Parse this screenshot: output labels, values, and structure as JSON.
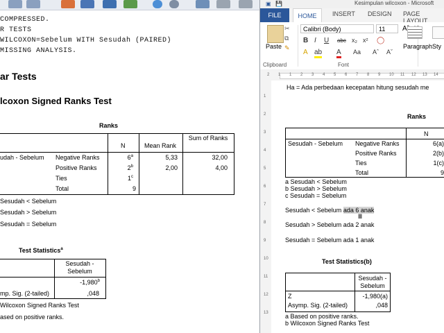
{
  "spss": {
    "syntax_lines": [
      "COMPRESSED.",
      "R TESTS",
      "WILCOXON=Sebelum WITH Sesudah (PAIRED)",
      "MISSING ANALYSIS."
    ],
    "section_title": "ar Tests",
    "subsection_title": "lcoxon Signed Ranks Test",
    "ranks": {
      "title": "Ranks",
      "headers": [
        "N",
        "Mean Rank",
        "Sum of Ranks"
      ],
      "pair_label": "udah - Sebelum",
      "rows": [
        {
          "label": "Negative Ranks",
          "n": "6",
          "sup": "a",
          "mean": "5,33",
          "sum": "32,00"
        },
        {
          "label": "Positive Ranks",
          "n": "2",
          "sup": "b",
          "mean": "2,00",
          "sum": "4,00"
        },
        {
          "label": "Ties",
          "n": "1",
          "sup": "c",
          "mean": "",
          "sum": ""
        },
        {
          "label": "Total",
          "n": "9",
          "sup": "",
          "mean": "",
          "sum": ""
        }
      ],
      "footnotes": [
        "Sesudah < Sebelum",
        "Sesudah > Sebelum",
        "Sesudah = Sebelum"
      ]
    },
    "test_stats": {
      "title": "Test Statistics",
      "title_sup": "a",
      "header": "Sesudah - Sebelum",
      "z_value": "-1,980",
      "z_sup": "b",
      "sig_label": "mp. Sig. (2-tailed)",
      "sig_value": ",048",
      "footnotes": [
        "Wilcoxon Signed Ranks Test",
        "ased on positive ranks."
      ]
    }
  },
  "word": {
    "window_title": "Kesimpulan wilcoxon - Microsoft",
    "tabs": [
      "FILE",
      "HOME",
      "INSERT",
      "DESIGN",
      "PAGE LAYOUT"
    ],
    "font_name": "Calibri (Body)",
    "font_size": "11",
    "group_labels": {
      "clipboard": "Clipboard",
      "font": "Font",
      "paragraph": "Paragraph",
      "styles": "Sty"
    },
    "paste_label": "Paste",
    "ruler_numbers": [
      "2",
      "1",
      "1",
      "2",
      "3",
      "4",
      "5",
      "6",
      "7",
      "8",
      "9",
      "10",
      "11",
      "12",
      "13",
      "14"
    ],
    "vruler_numbers": [
      "1",
      "2",
      "3",
      "4",
      "5",
      "6",
      "7",
      "8",
      "9",
      "10",
      "11",
      "12",
      "13"
    ],
    "doc": {
      "intro": "Ha = Ada perbedaan kecepatan hitung sesudah me",
      "ranks_title": "Ranks",
      "ranks_header_n": "N",
      "pair_label": "Sesudah - Sebelum",
      "rows": [
        {
          "label": "Negative Ranks",
          "n": "6(a)"
        },
        {
          "label": "Positive Ranks",
          "n": "2(b)"
        },
        {
          "label": "Ties",
          "n": "1(c)"
        },
        {
          "label": "Total",
          "n": "9"
        }
      ],
      "footnotes": [
        "a  Sesudah < Sebelum",
        "b  Sesudah > Sebelum",
        "c  Sesudah = Sebelum"
      ],
      "conclusion_prefix": "Sesudah < Sebelum ",
      "conclusion_highlight": "ada 6 anak",
      "conclusion2": "Sesudah > Sebelum ada 2 anak",
      "conclusion3": "Sesudah = Sebelum ada 1 anak",
      "stats_title": "Test Statistics(b)",
      "stats_header": "Sesudah - Sebelum",
      "z_label": "Z",
      "z_value": "-1,980(a)",
      "sig_label": "Asymp. Sig. (2-tailed)",
      "sig_value": ",048",
      "stats_footnotes": [
        "a  Based on positive ranks.",
        "b  Wilcoxon Signed Ranks Test"
      ]
    }
  }
}
